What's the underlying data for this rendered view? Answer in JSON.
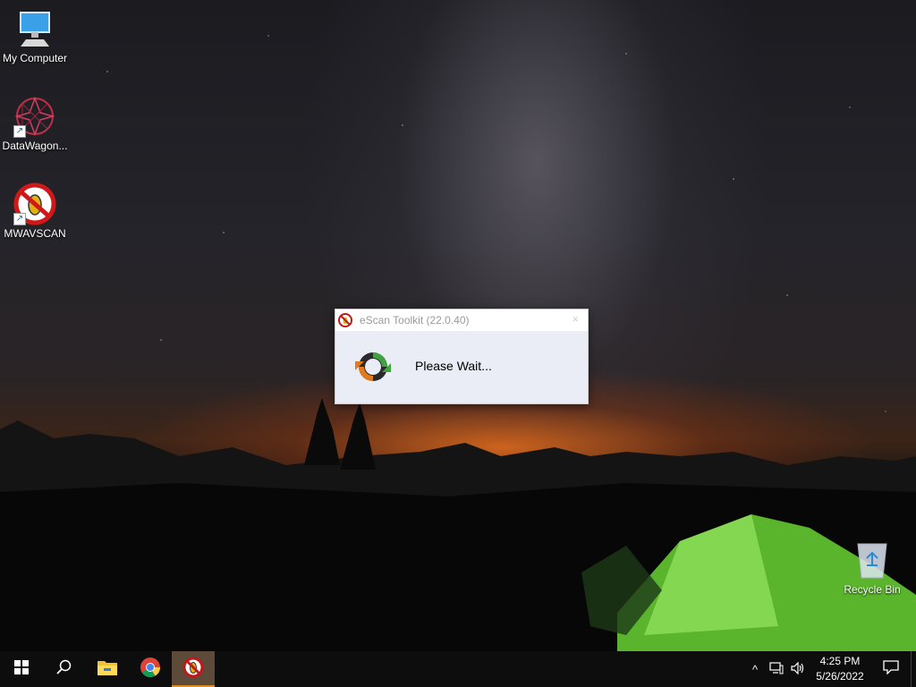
{
  "desktop": {
    "icons": [
      {
        "label": "My Computer",
        "icon": "computer-icon"
      },
      {
        "label": "DataWagon...",
        "icon": "datawagon-icon"
      },
      {
        "label": "MWAVSCAN",
        "icon": "mwavscan-icon"
      },
      {
        "label": "Recycle Bin",
        "icon": "recycle-bin-icon"
      }
    ]
  },
  "dialog": {
    "title": "eScan Toolkit (22.0.40)",
    "close_symbol": "×",
    "message": "Please Wait..."
  },
  "taskbar": {
    "start": "start-icon",
    "search": "search-icon",
    "pinned": [
      "file-explorer-icon",
      "chrome-icon",
      "escan-icon"
    ],
    "active_app": "escan-icon",
    "tray": {
      "chevron": "^",
      "time": "4:25 PM",
      "date": "5/26/2022"
    }
  },
  "colors": {
    "taskbar_bg": "#0d0d0d",
    "active_accent": "#e08a2a",
    "dialog_bg": "#eaedf6"
  }
}
